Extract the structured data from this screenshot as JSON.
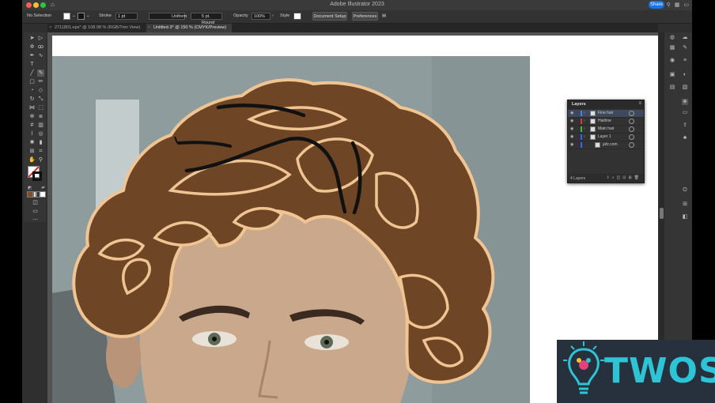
{
  "window": {
    "title": "Adobe Illustrator 2023",
    "share_label": "Share",
    "traffic_colors": [
      "#ff5f57",
      "#febc2e",
      "#28c840"
    ]
  },
  "control_bar": {
    "selection": "No Selection",
    "stroke_label": "Stroke",
    "stroke_weight": "1 pt",
    "profile": "Uniform",
    "brush": "5 pt. Round",
    "opacity_label": "Opacity",
    "opacity_value": "100%",
    "style_label": "Style",
    "document_setup": "Document Setup",
    "preferences": "Preferences"
  },
  "tabs": [
    {
      "label": "2711801.eps* @ 108.98 % (RGB/Trim View)",
      "active": false
    },
    {
      "label": "Untitled-3* @ 150 % (CMYK/Preview)",
      "active": true
    }
  ],
  "layers_panel": {
    "title": "Layers",
    "rows": [
      {
        "name": "Fine hair",
        "color": "#4f7bff",
        "selected": true,
        "expandable": true
      },
      {
        "name": "Hairline",
        "color": "#e03838",
        "selected": false,
        "expandable": true
      },
      {
        "name": "Main hair",
        "color": "#3fbf3f",
        "selected": false,
        "expandable": true
      },
      {
        "name": "Layer 1",
        "color": "#2f66ff",
        "selected": false,
        "expandable": true
      },
      {
        "name": "jafz.com",
        "color": "#2f66ff",
        "selected": false,
        "expandable": false
      }
    ],
    "footer_count": "4 Layers"
  },
  "watermark": {
    "text": "TWOS",
    "accent": "#2dc5d6",
    "background": "#27303d"
  },
  "colors": {
    "hair_fill": "#6e4626",
    "hair_outline": "#f0c593",
    "hair_stroke": "#111111",
    "background_wall": "#8d9b9c",
    "skin": "#c9a88c"
  }
}
